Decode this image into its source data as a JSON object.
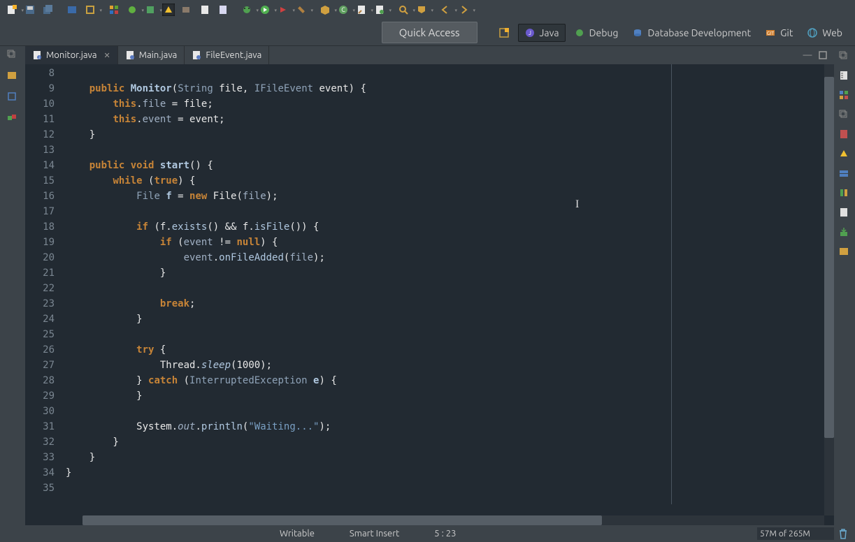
{
  "quick_access": {
    "placeholder": "Quick Access"
  },
  "perspectives": [
    {
      "label": "Java",
      "active": true
    },
    {
      "label": "Debug",
      "active": false
    },
    {
      "label": "Database Development",
      "active": false
    },
    {
      "label": "Git",
      "active": false
    },
    {
      "label": "Web",
      "active": false
    }
  ],
  "tabs": [
    {
      "label": "Monitor.java",
      "active": true
    },
    {
      "label": "Main.java",
      "active": false
    },
    {
      "label": "FileEvent.java",
      "active": false
    }
  ],
  "line_start": 8,
  "line_end": 35,
  "code_lines": [
    {
      "n": 8,
      "tokens": []
    },
    {
      "n": 9,
      "tokens": [
        {
          "c": "    ",
          "t": ""
        },
        {
          "c": "public",
          "t": "kw"
        },
        {
          "c": " ",
          "t": ""
        },
        {
          "c": "Monitor",
          "t": "method"
        },
        {
          "c": "(",
          "t": ""
        },
        {
          "c": "String",
          "t": "type"
        },
        {
          "c": " file, ",
          "t": ""
        },
        {
          "c": "IFileEvent",
          "t": "type"
        },
        {
          "c": " event) {",
          "t": ""
        }
      ]
    },
    {
      "n": 10,
      "tokens": [
        {
          "c": "        ",
          "t": ""
        },
        {
          "c": "this",
          "t": "kw"
        },
        {
          "c": ".",
          "t": ""
        },
        {
          "c": "file",
          "t": "field"
        },
        {
          "c": " = file;",
          "t": ""
        }
      ]
    },
    {
      "n": 11,
      "tokens": [
        {
          "c": "        ",
          "t": ""
        },
        {
          "c": "this",
          "t": "kw"
        },
        {
          "c": ".",
          "t": ""
        },
        {
          "c": "event",
          "t": "field"
        },
        {
          "c": " = event;",
          "t": ""
        }
      ]
    },
    {
      "n": 12,
      "tokens": [
        {
          "c": "    }",
          "t": ""
        }
      ]
    },
    {
      "n": 13,
      "tokens": []
    },
    {
      "n": 14,
      "tokens": [
        {
          "c": "    ",
          "t": ""
        },
        {
          "c": "public",
          "t": "kw"
        },
        {
          "c": " ",
          "t": ""
        },
        {
          "c": "void",
          "t": "kw"
        },
        {
          "c": " ",
          "t": ""
        },
        {
          "c": "start",
          "t": "method"
        },
        {
          "c": "() {",
          "t": ""
        }
      ]
    },
    {
      "n": 15,
      "tokens": [
        {
          "c": "        ",
          "t": ""
        },
        {
          "c": "while",
          "t": "kw"
        },
        {
          "c": " (",
          "t": ""
        },
        {
          "c": "true",
          "t": "kw"
        },
        {
          "c": ") {",
          "t": ""
        }
      ]
    },
    {
      "n": 16,
      "tokens": [
        {
          "c": "            ",
          "t": ""
        },
        {
          "c": "File",
          "t": "type"
        },
        {
          "c": " ",
          "t": ""
        },
        {
          "c": "f",
          "t": "method"
        },
        {
          "c": " = ",
          "t": ""
        },
        {
          "c": "new",
          "t": "kw"
        },
        {
          "c": " File(",
          "t": ""
        },
        {
          "c": "file",
          "t": "field"
        },
        {
          "c": ");",
          "t": ""
        }
      ]
    },
    {
      "n": 17,
      "tokens": []
    },
    {
      "n": 18,
      "tokens": [
        {
          "c": "            ",
          "t": ""
        },
        {
          "c": "if",
          "t": "kw"
        },
        {
          "c": " (f.",
          "t": ""
        },
        {
          "c": "exists",
          "t": "methodcall"
        },
        {
          "c": "() && f.",
          "t": ""
        },
        {
          "c": "isFile",
          "t": "methodcall"
        },
        {
          "c": "()) {",
          "t": ""
        }
      ]
    },
    {
      "n": 19,
      "tokens": [
        {
          "c": "                ",
          "t": ""
        },
        {
          "c": "if",
          "t": "kw"
        },
        {
          "c": " (",
          "t": ""
        },
        {
          "c": "event",
          "t": "field"
        },
        {
          "c": " != ",
          "t": ""
        },
        {
          "c": "null",
          "t": "kw"
        },
        {
          "c": ") {",
          "t": ""
        }
      ]
    },
    {
      "n": 20,
      "tokens": [
        {
          "c": "                    ",
          "t": ""
        },
        {
          "c": "event",
          "t": "field"
        },
        {
          "c": ".",
          "t": ""
        },
        {
          "c": "onFileAdded",
          "t": "methodcall"
        },
        {
          "c": "(",
          "t": ""
        },
        {
          "c": "file",
          "t": "field"
        },
        {
          "c": ");",
          "t": ""
        }
      ]
    },
    {
      "n": 21,
      "tokens": [
        {
          "c": "                }",
          "t": ""
        }
      ]
    },
    {
      "n": 22,
      "tokens": []
    },
    {
      "n": 23,
      "tokens": [
        {
          "c": "                ",
          "t": ""
        },
        {
          "c": "break",
          "t": "kw"
        },
        {
          "c": ";",
          "t": ""
        }
      ]
    },
    {
      "n": 24,
      "tokens": [
        {
          "c": "            }",
          "t": ""
        }
      ]
    },
    {
      "n": 25,
      "tokens": []
    },
    {
      "n": 26,
      "tokens": [
        {
          "c": "            ",
          "t": ""
        },
        {
          "c": "try",
          "t": "kw"
        },
        {
          "c": " {",
          "t": ""
        }
      ]
    },
    {
      "n": 27,
      "tokens": [
        {
          "c": "                Thread.",
          "t": ""
        },
        {
          "c": "sleep",
          "t": "italmethod"
        },
        {
          "c": "(1000);",
          "t": ""
        }
      ]
    },
    {
      "n": 28,
      "tokens": [
        {
          "c": "            } ",
          "t": ""
        },
        {
          "c": "catch",
          "t": "kw"
        },
        {
          "c": " (",
          "t": ""
        },
        {
          "c": "InterruptedException",
          "t": "type"
        },
        {
          "c": " ",
          "t": ""
        },
        {
          "c": "e",
          "t": "method"
        },
        {
          "c": ") {",
          "t": ""
        }
      ]
    },
    {
      "n": 29,
      "tokens": [
        {
          "c": "            }",
          "t": ""
        }
      ]
    },
    {
      "n": 30,
      "tokens": []
    },
    {
      "n": 31,
      "tokens": [
        {
          "c": "            System.",
          "t": ""
        },
        {
          "c": "out",
          "t": "static-field"
        },
        {
          "c": ".",
          "t": ""
        },
        {
          "c": "println",
          "t": "methodcall"
        },
        {
          "c": "(",
          "t": ""
        },
        {
          "c": "\"Waiting...\"",
          "t": "str"
        },
        {
          "c": ");",
          "t": ""
        }
      ]
    },
    {
      "n": 32,
      "tokens": [
        {
          "c": "        }",
          "t": ""
        }
      ]
    },
    {
      "n": 33,
      "tokens": [
        {
          "c": "    }",
          "t": ""
        }
      ]
    },
    {
      "n": 34,
      "tokens": [
        {
          "c": "}",
          "t": ""
        }
      ]
    },
    {
      "n": 35,
      "tokens": []
    }
  ],
  "status": {
    "writable": "Writable",
    "insert_mode": "Smart Insert",
    "cursor": "5 : 23",
    "heap": "57M of 265M"
  }
}
